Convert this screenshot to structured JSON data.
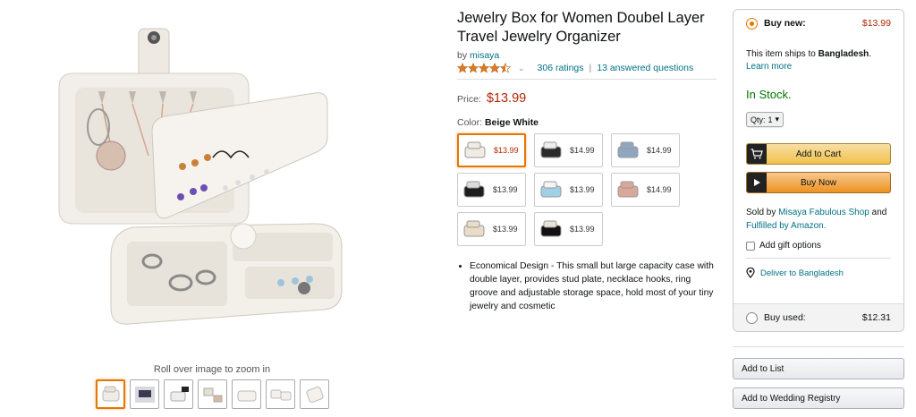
{
  "gallery": {
    "zoom_hint": "Roll over image to zoom in",
    "thumbnails": [
      "thumb-1",
      "thumb-2",
      "thumb-3",
      "thumb-4",
      "thumb-5",
      "thumb-6",
      "thumb-7"
    ]
  },
  "product": {
    "title": "Jewelry Box for Women Doubel Layer Travel Jewelry Organizer",
    "by_prefix": "by",
    "brand": "misaya",
    "rating_value": 4.5,
    "ratings_count": "306 ratings",
    "answered": "13 answered questions",
    "price_label": "Price:",
    "price": "$13.99",
    "color_label": "Color:",
    "color_value": "Beige White",
    "swatches": [
      {
        "price": "$13.99",
        "color": "#f0ebe3"
      },
      {
        "price": "$14.99",
        "color": "#2a2a2a"
      },
      {
        "price": "$14.99",
        "color": "#8fa6bf"
      },
      {
        "price": "$13.99",
        "color": "#1e1e1e"
      },
      {
        "price": "$13.99",
        "color": "#9fd0e6"
      },
      {
        "price": "$14.99",
        "color": "#d9a89a"
      },
      {
        "price": "$13.99",
        "color": "#e9dcc9"
      },
      {
        "price": "$13.99",
        "color": "#111111"
      }
    ],
    "bullet": "Economical Design - This small but large capacity case with double layer, provides stud plate, necklace hooks, ring groove and adjustable storage space, hold most of your tiny jewelry and cosmetic"
  },
  "buybox": {
    "buy_new_label": "Buy new:",
    "buy_new_price": "$13.99",
    "ships_prefix": "This item ships to",
    "ships_country": "Bangladesh",
    "ships_suffix": ".",
    "learn_more": "Learn more",
    "stock": "In Stock.",
    "qty_label": "Qty:",
    "qty_value": "1",
    "add_to_cart": "Add to Cart",
    "buy_now": "Buy Now",
    "sold_by_prefix": "Sold by",
    "seller": "Misaya Fabulous Shop",
    "and": "and",
    "fulfilled": "Fulfilled by Amazon.",
    "gift": "Add gift options",
    "deliver": "Deliver to Bangladesh",
    "buy_used_label": "Buy used:",
    "buy_used_price": "$12.31"
  },
  "actions": {
    "add_to_list": "Add to List",
    "add_to_registry": "Add to Wedding Registry"
  },
  "colors": {
    "accent_orange": "#e77600",
    "price_red": "#b12704",
    "link_teal": "#007185",
    "stock_green": "#007600",
    "star_gold": "#de7921"
  }
}
